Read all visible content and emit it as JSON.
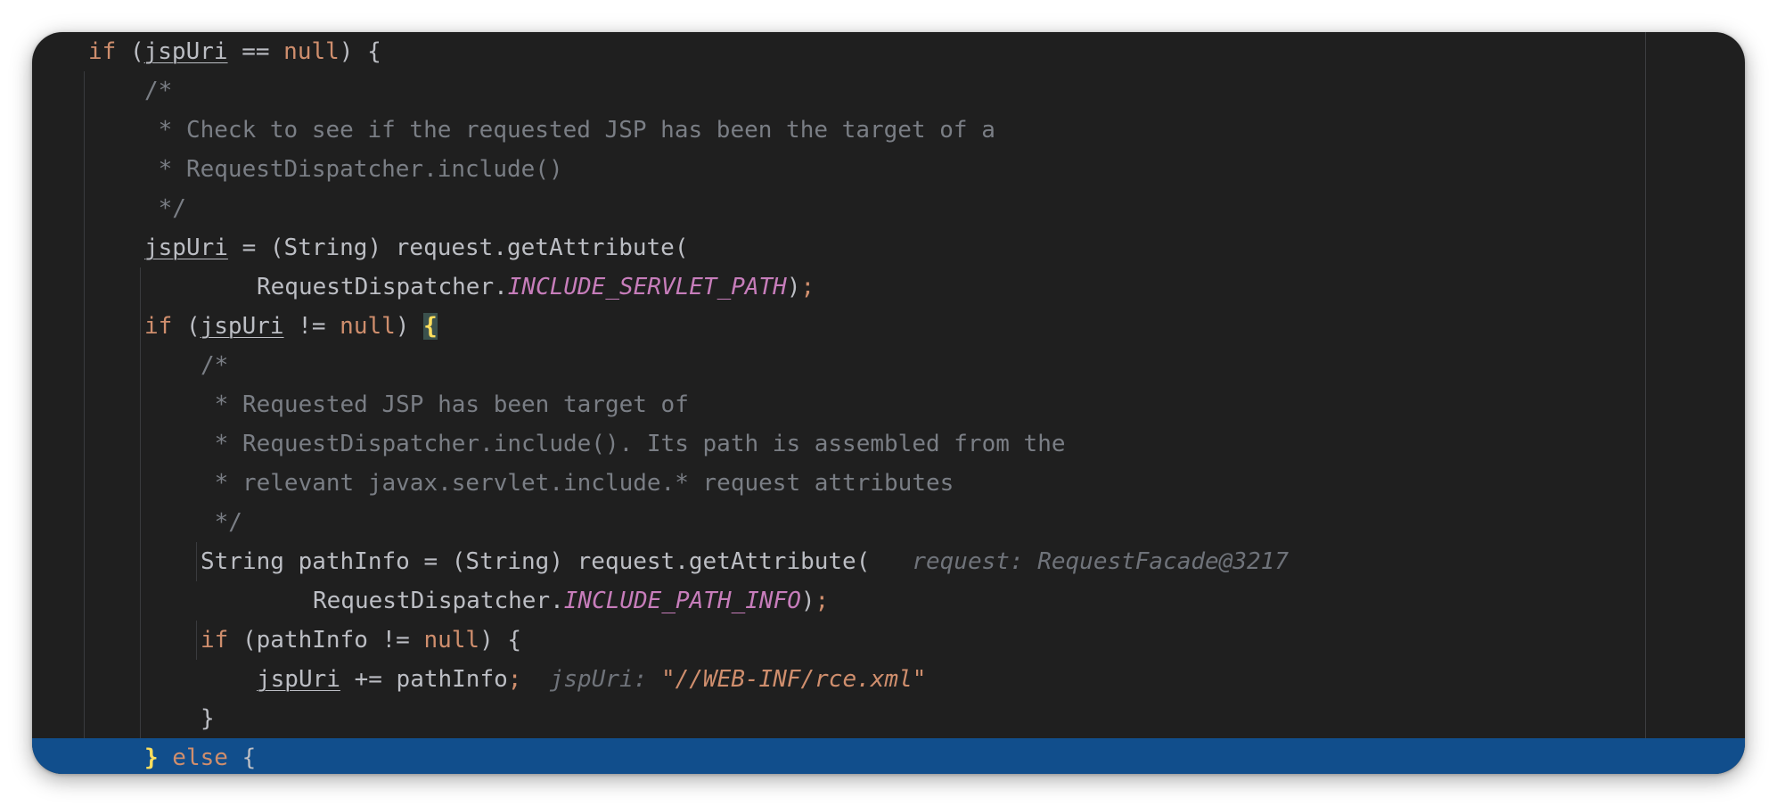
{
  "editor": {
    "lines": [
      {
        "t1": "if",
        "t2": " (",
        "t3": "jspUri",
        "t4": " == ",
        "t5": "null",
        "t6": ") {"
      },
      {
        "text": "/*"
      },
      {
        "text": " * Check to see if the requested JSP has been the target of a"
      },
      {
        "text": " * RequestDispatcher.include()"
      },
      {
        "text": " */"
      },
      {
        "t1": "jspUri",
        "t2": " = (String) request.getAttribute("
      },
      {
        "t1": "RequestDispatcher.",
        "t2": "INCLUDE_SERVLET_PATH",
        "t3": ")",
        "t4": ";"
      },
      {
        "t1": "if",
        "t2": " (",
        "t3": "jspUri",
        "t4": " != ",
        "t5": "null",
        "t6": ") ",
        "t7": "{"
      },
      {
        "text": "/*"
      },
      {
        "text": " * Requested JSP has been target of"
      },
      {
        "text": " * RequestDispatcher.include(). Its path is assembled from the"
      },
      {
        "text": " * relevant javax.servlet.include.* request attributes"
      },
      {
        "text": " */"
      },
      {
        "t1": "String pathInfo = (String) request.getAttribute(",
        "hint": "request: RequestFacade@3217"
      },
      {
        "t1": "RequestDispatcher.",
        "t2": "INCLUDE_PATH_INFO",
        "t3": ")",
        "t4": ";"
      },
      {
        "t1": "if",
        "t2": " (pathInfo != ",
        "t3": "null",
        "t4": ") {"
      },
      {
        "t1": "jspUri",
        "t2": " += pathInfo",
        "t3": ";",
        "hint_label": "jspUri: ",
        "hint_value": "\"//WEB-INF/rce.xml\""
      },
      {
        "text": "}"
      },
      {
        "t1": "}",
        "t2": " else",
        "t3": " {"
      }
    ]
  },
  "colors": {
    "background": "#1f1f1f",
    "keyword": "#cf8e6d",
    "comment": "#7a7e85",
    "field": "#c77dbb",
    "current_line": "#114e8c"
  }
}
